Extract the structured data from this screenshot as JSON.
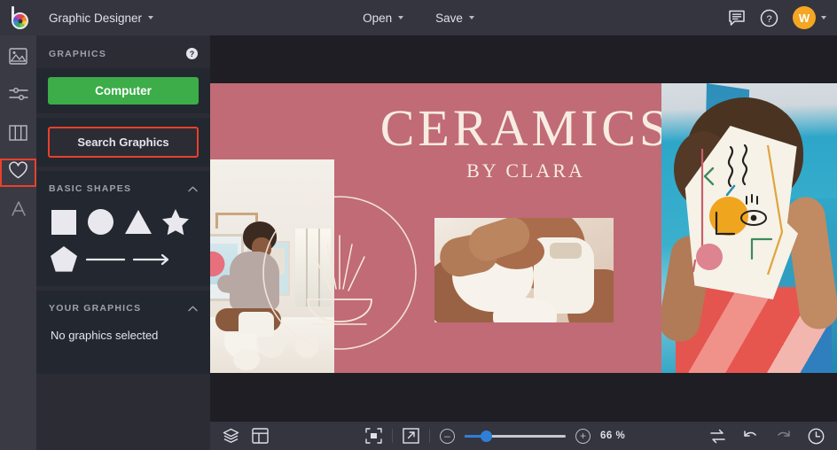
{
  "app": {
    "logo": "befunky-logo",
    "document_title": "Graphic Designer"
  },
  "topbar": {
    "open_label": "Open",
    "save_label": "Save",
    "icons": {
      "comment": "comment-icon",
      "help": "help-circle-icon",
      "avatar_initial": "W"
    }
  },
  "rail": {
    "items": [
      {
        "name": "image-manager",
        "icon": "image-icon"
      },
      {
        "name": "edit-adjust",
        "icon": "sliders-icon"
      },
      {
        "name": "templates",
        "icon": "columns-icon"
      },
      {
        "name": "graphics",
        "icon": "heart-icon",
        "active": true
      },
      {
        "name": "text",
        "icon": "text-a-icon"
      }
    ]
  },
  "panel": {
    "title": "GRAPHICS",
    "help_icon": "question-mark-icon",
    "computer_button": "Computer",
    "search_button": "Search Graphics",
    "basic_shapes": {
      "title": "BASIC SHAPES",
      "collapse_icon": "chevron-up-icon",
      "shapes": [
        "square-shape",
        "circle-shape",
        "triangle-shape",
        "star-shape",
        "pentagon-shape",
        "line-shape",
        "arrow-shape"
      ]
    },
    "your_graphics": {
      "title": "YOUR GRAPHICS",
      "collapse_icon": "chevron-up-icon",
      "empty_message": "No graphics selected"
    }
  },
  "canvas": {
    "design": {
      "headline": "CERAMICS",
      "subhead": "BY CLARA",
      "background_color": "#c06b76",
      "accent_color": "#2ba3c6",
      "text_color": "#f7ece2",
      "emblem": "ceramic-bowl-line-icon"
    }
  },
  "bottombar": {
    "layers_icon": "layers-icon",
    "template_icon": "layout-icon",
    "fit_icon": "fit-to-screen-icon",
    "expand_icon": "open-external-icon",
    "zoom_out_icon": "minus-icon",
    "zoom_in_icon": "plus-icon",
    "zoom_level": "66 %",
    "compare_icon": "compare-swap-icon",
    "undo_icon": "undo-arrow-icon",
    "redo_icon": "redo-arrow-icon",
    "history_icon": "history-clock-icon"
  },
  "colors": {
    "topbar_bg": "#35353f",
    "panel_bg": "#2c2c35",
    "block_bg": "#232730",
    "rail_bg": "#3a3a45",
    "canvas_bg": "#1e1e24",
    "green": "#3cad48",
    "highlight_red": "#e8412a",
    "avatar_orange": "#f5a623",
    "slider_blue": "#2f7fd6"
  }
}
